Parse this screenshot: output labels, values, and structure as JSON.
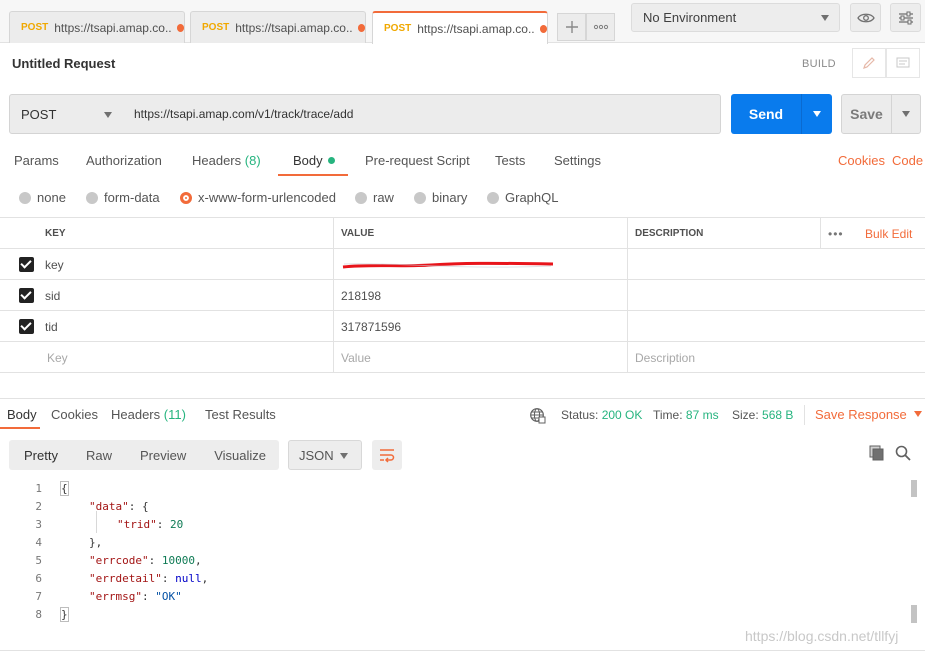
{
  "tabs": [
    {
      "method": "POST",
      "url": "https://tsapi.amap.co..."
    },
    {
      "method": "POST",
      "url": "https://tsapi.amap.co..."
    },
    {
      "method": "POST",
      "url": "https://tsapi.amap.co..."
    }
  ],
  "environment": {
    "selected": "No Environment"
  },
  "request": {
    "title": "Untitled Request",
    "build_label": "BUILD",
    "method": "POST",
    "url": "https://tsapi.amap.com/v1/track/trace/add",
    "send_label": "Send",
    "save_label": "Save"
  },
  "request_tabs": {
    "params": "Params",
    "authorization": "Authorization",
    "headers": "Headers",
    "headers_count": "(8)",
    "body": "Body",
    "prerequest": "Pre-request Script",
    "tests": "Tests",
    "settings": "Settings",
    "cookies": "Cookies",
    "code": "Code"
  },
  "body_types": [
    "none",
    "form-data",
    "x-www-form-urlencoded",
    "raw",
    "binary",
    "GraphQL"
  ],
  "body_type_selected": "x-www-form-urlencoded",
  "params_table": {
    "headers": {
      "key": "KEY",
      "value": "VALUE",
      "description": "DESCRIPTION",
      "more": "•••",
      "bulk_edit": "Bulk Edit"
    },
    "rows": [
      {
        "checked": true,
        "key": "key",
        "value": "",
        "redacted": true
      },
      {
        "checked": true,
        "key": "sid",
        "value": "218198"
      },
      {
        "checked": true,
        "key": "tid",
        "value": "317871596"
      }
    ],
    "placeholders": {
      "key": "Key",
      "value": "Value",
      "description": "Description"
    }
  },
  "response": {
    "tabs": {
      "body": "Body",
      "cookies": "Cookies",
      "headers": "Headers",
      "headers_count": "(11)",
      "test_results": "Test Results"
    },
    "status_label": "Status:",
    "status_value": "200 OK",
    "time_label": "Time:",
    "time_value": "87 ms",
    "size_label": "Size:",
    "size_value": "568 B",
    "save_response": "Save Response",
    "views": [
      "Pretty",
      "Raw",
      "Preview",
      "Visualize"
    ],
    "format": "JSON",
    "line_numbers": [
      "1",
      "2",
      "3",
      "4",
      "5",
      "6",
      "7",
      "8"
    ],
    "json": {
      "l1": "{",
      "l2_key": "\"data\"",
      "l2_rest": ": {",
      "l3_key": "\"trid\"",
      "l3_val": "20",
      "l4": "},",
      "l5_key": "\"errcode\"",
      "l5_val": "10000",
      "l6_key": "\"errdetail\"",
      "l6_val": "null",
      "l7_key": "\"errmsg\"",
      "l7_val": "\"OK\"",
      "l8": "}"
    }
  },
  "watermark": "https://blog.csdn.net/tllfyj",
  "colors": {
    "accent": "#f26b3a",
    "send": "#097bed",
    "ok": "#26b47f",
    "method": "#f0a800"
  }
}
